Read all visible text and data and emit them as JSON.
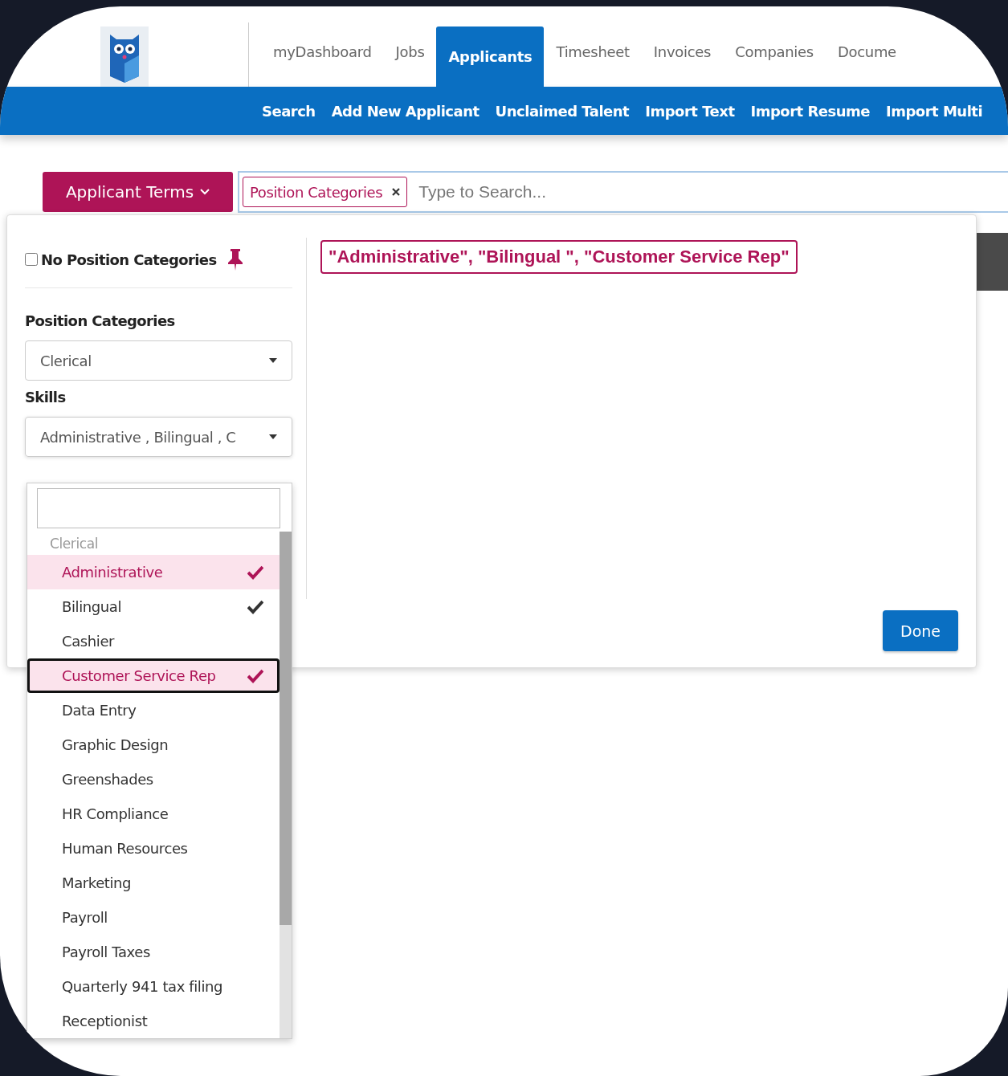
{
  "nav": {
    "tabs": [
      {
        "label": "myDashboard",
        "selected": false
      },
      {
        "label": "Jobs",
        "selected": false
      },
      {
        "label": "Applicants",
        "selected": true
      },
      {
        "label": "Timesheet",
        "selected": false
      },
      {
        "label": "Invoices",
        "selected": false
      },
      {
        "label": "Companies",
        "selected": false
      },
      {
        "label": "Docume",
        "selected": false
      }
    ]
  },
  "subnav": [
    "Search",
    "Add New Applicant",
    "Unclaimed Talent",
    "Import Text",
    "Import Resume",
    "Import Multi"
  ],
  "filter_button": "Applicant Terms",
  "search": {
    "tags": [
      {
        "label": "Position Categories"
      }
    ],
    "placeholder": "Type to Search..."
  },
  "panel": {
    "no_category": {
      "label": "No Position Categories",
      "checked": false
    },
    "position_categories": {
      "label": "Position Categories",
      "value": "Clerical"
    },
    "skills": {
      "label": "Skills",
      "value": "Administrative , Bilingual , C"
    },
    "dropdown": {
      "group": "Clerical",
      "items": [
        {
          "label": "Administrative",
          "checked": true,
          "selected": true,
          "focused": false
        },
        {
          "label": "Bilingual",
          "checked": true,
          "selected": false,
          "focused": false
        },
        {
          "label": "Cashier",
          "checked": false,
          "selected": false,
          "focused": false
        },
        {
          "label": "Customer Service Rep",
          "checked": true,
          "selected": true,
          "focused": true
        },
        {
          "label": "Data Entry",
          "checked": false,
          "selected": false,
          "focused": false
        },
        {
          "label": "Graphic Design",
          "checked": false,
          "selected": false,
          "focused": false
        },
        {
          "label": "Greenshades",
          "checked": false,
          "selected": false,
          "focused": false
        },
        {
          "label": "HR Compliance",
          "checked": false,
          "selected": false,
          "focused": false
        },
        {
          "label": "Human Resources",
          "checked": false,
          "selected": false,
          "focused": false
        },
        {
          "label": "Marketing",
          "checked": false,
          "selected": false,
          "focused": false
        },
        {
          "label": "Payroll",
          "checked": false,
          "selected": false,
          "focused": false
        },
        {
          "label": "Payroll Taxes",
          "checked": false,
          "selected": false,
          "focused": false
        },
        {
          "label": "Quarterly 941 tax filing",
          "checked": false,
          "selected": false,
          "focused": false
        },
        {
          "label": "Receptionist",
          "checked": false,
          "selected": false,
          "focused": false
        }
      ]
    },
    "selection": "\"Administrative\", \"Bilingual \", \"Customer Service Rep\"",
    "done": "Done"
  }
}
